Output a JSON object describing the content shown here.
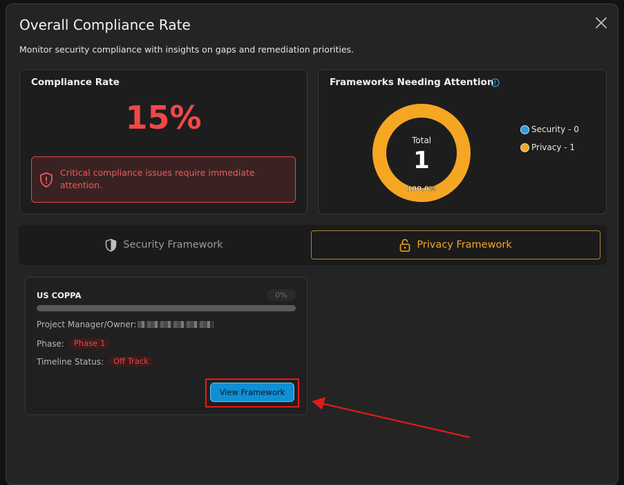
{
  "modal": {
    "title": "Overall Compliance Rate",
    "subtitle": "Monitor security compliance with insights on gaps and remediation priorities.",
    "close_icon": "close-icon"
  },
  "compliance_card": {
    "title": "Compliance Rate",
    "value": "15%",
    "alert_text": "Critical compliance issues require immediate attention.",
    "alert_icon": "shield-alert-icon"
  },
  "frameworks_card": {
    "title": "Frameworks Needing Attention",
    "info_icon": "info-icon",
    "donut_label": "Total",
    "donut_total": "1",
    "donut_percent": "100.0%",
    "legend": [
      {
        "label": "Security - 0",
        "color": "#2a9fe0"
      },
      {
        "label": "Privacy - 1",
        "color": "#f5a623"
      }
    ]
  },
  "tabs": [
    {
      "label": "Security Framework",
      "icon": "shield-icon",
      "active": false
    },
    {
      "label": "Privacy Framework",
      "icon": "lock-icon",
      "active": true
    }
  ],
  "framework": {
    "name": "US COPPA",
    "percent": "0%",
    "progress": 0,
    "owner_label": "Project Manager/Owner:",
    "phase_label": "Phase:",
    "phase_value": "Phase 1",
    "timeline_label": "Timeline Status:",
    "timeline_value": "Off Track",
    "button_label": "View Framework"
  },
  "colors": {
    "accent_orange": "#f5a623",
    "danger_red": "#f04848",
    "button_blue": "#0f8fd6"
  }
}
